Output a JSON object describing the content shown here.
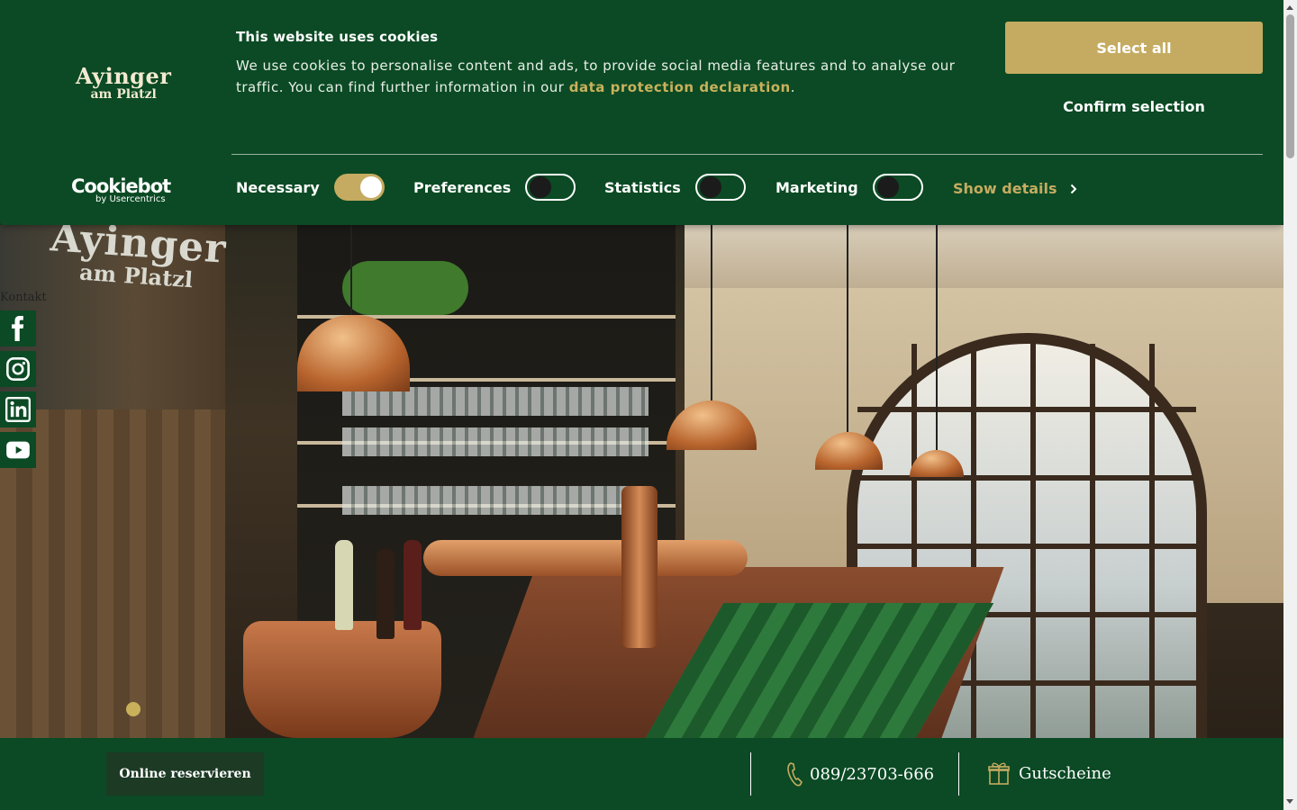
{
  "cookie_banner": {
    "brand_logo": {
      "line1": "Ayinger",
      "line2": "am Platzl"
    },
    "title": "This website uses cookies",
    "text_before_link": "We use cookies to personalise content and ads, to provide social media features and to analyse our traffic. You can find further information in our ",
    "link_text": "data protection declaration",
    "text_after_link": ".",
    "select_all_label": "Select all",
    "confirm_label": "Confirm selection",
    "provider": {
      "name": "Cookiebot",
      "by": "by Usercentrics"
    },
    "toggles": [
      {
        "label": "Necessary",
        "checked": true,
        "disabled": true
      },
      {
        "label": "Preferences",
        "checked": false
      },
      {
        "label": "Statistics",
        "checked": false
      },
      {
        "label": "Marketing",
        "checked": false
      }
    ],
    "show_details_label": "Show details"
  },
  "hero": {
    "wall_logo": {
      "line1": "Ayinger",
      "line2": "am Platzl"
    },
    "slide_count": 1,
    "active_slide": 1
  },
  "sidebar": {
    "kontakt_label": "Kontakt",
    "social": [
      {
        "name": "facebook",
        "icon": "facebook-icon"
      },
      {
        "name": "instagram",
        "icon": "instagram-icon"
      },
      {
        "name": "linkedin",
        "icon": "linkedin-icon"
      },
      {
        "name": "youtube",
        "icon": "youtube-icon"
      }
    ]
  },
  "bottom_bar": {
    "reserve_label": "Online reservieren",
    "phone": "089/23703-666",
    "voucher_label": "Gutscheine"
  },
  "colors": {
    "brand_green": "#0b4a24",
    "accent_gold": "#c5ab61",
    "dark_button": "#1d3a24"
  }
}
